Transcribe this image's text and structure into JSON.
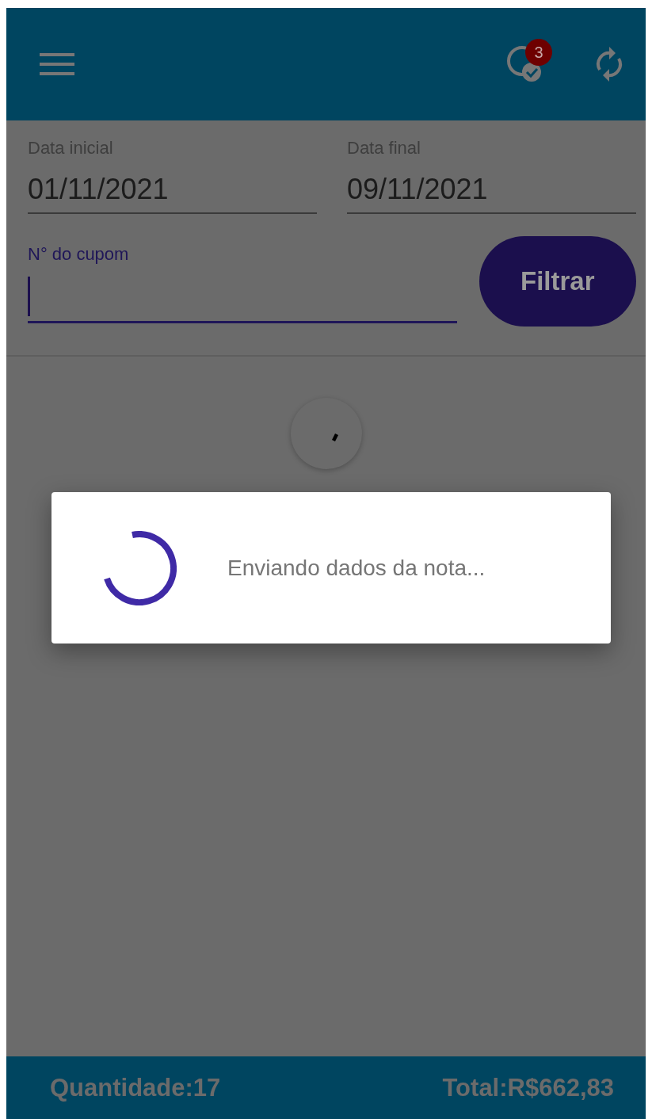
{
  "app_bar": {
    "notification_count": "3"
  },
  "filters": {
    "date_start": {
      "label": "Data inicial",
      "value": "01/11/2021"
    },
    "date_end": {
      "label": "Data final",
      "value": "09/11/2021"
    },
    "coupon": {
      "label": "N° do cupom",
      "focused": true
    },
    "button": "Filtrar"
  },
  "loading_dialog": {
    "message": "Enviando dados da nota..."
  },
  "footer": {
    "quantity": "Quantidade:17",
    "total": "Total:R$662,83"
  }
}
